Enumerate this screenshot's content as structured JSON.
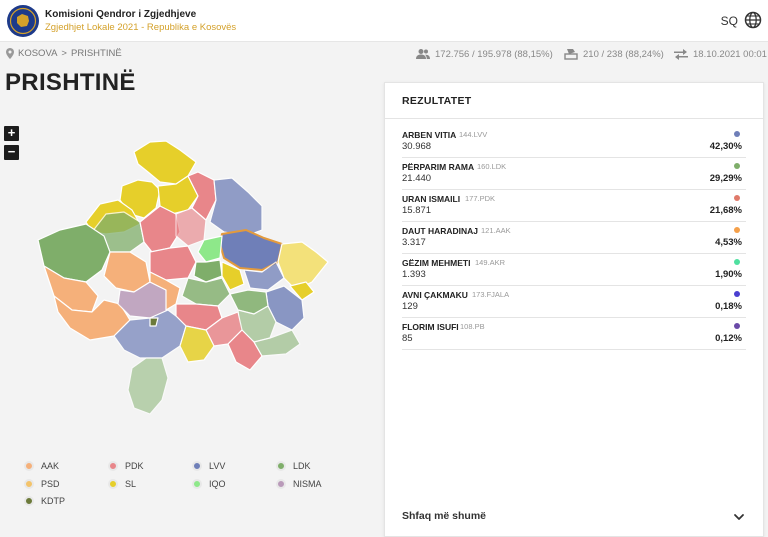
{
  "header": {
    "org_name": "Komisioni Qendror i Zgjedhjeve",
    "subtitle": "Zgjedhjet Lokale 2021 - Republika e Kosovës",
    "language": "SQ"
  },
  "breadcrumb": {
    "level1": "KOSOVA",
    "separator": ">",
    "level2": "PRISHTINË"
  },
  "stats": {
    "voters": "172.756 / 195.978 (88,15%)",
    "stations": "210 / 238 (88,24%)",
    "updated": "18.10.2021 00:01"
  },
  "page_title": "PRISHTINË",
  "zoom": {
    "in": "+",
    "out": "−"
  },
  "legend": [
    {
      "label": "AAK",
      "color": "#f5b07a"
    },
    {
      "label": "PDK",
      "color": "#e8868a"
    },
    {
      "label": "LVV",
      "color": "#6f7fb8"
    },
    {
      "label": "LDK",
      "color": "#7fae6a"
    },
    {
      "label": "PSD",
      "color": "#f3c36a"
    },
    {
      "label": "SL",
      "color": "#e6cf2a"
    },
    {
      "label": "IQO",
      "color": "#8ee88a"
    },
    {
      "label": "NISMA",
      "color": "#b99ab9"
    },
    {
      "label": "KDTP",
      "color": "#6c7a3a"
    }
  ],
  "results": {
    "title": "REZULTATET",
    "candidates": [
      {
        "name": "ARBEN VITIA",
        "party": "144.LVV",
        "votes": "30.968",
        "percent": "42,30%",
        "color": "#6f7fb8"
      },
      {
        "name": "PËRPARIM RAMA",
        "party": "160.LDK",
        "votes": "21.440",
        "percent": "29,29%",
        "color": "#7fae6a"
      },
      {
        "name": "URAN ISMAILI",
        "party": "177.PDK",
        "votes": "15.871",
        "percent": "21,68%",
        "color": "#e07a6a"
      },
      {
        "name": "DAUT HARADINAJ",
        "party": "121.AAK",
        "votes": "3.317",
        "percent": "4,53%",
        "color": "#f5a04a"
      },
      {
        "name": "GËZIM MEHMETI",
        "party": "149.AKR",
        "votes": "1.393",
        "percent": "1,90%",
        "color": "#4fe0a0"
      },
      {
        "name": "AVNI ÇAKMAKU",
        "party": "173.FJALA",
        "votes": "129",
        "percent": "0,18%",
        "color": "#4a3fd0"
      },
      {
        "name": "FLORIM ISUFI",
        "party": "108.PB",
        "votes": "85",
        "percent": "0,12%",
        "color": "#6a4aa8"
      }
    ],
    "show_more": "Shfaq më shumë"
  }
}
